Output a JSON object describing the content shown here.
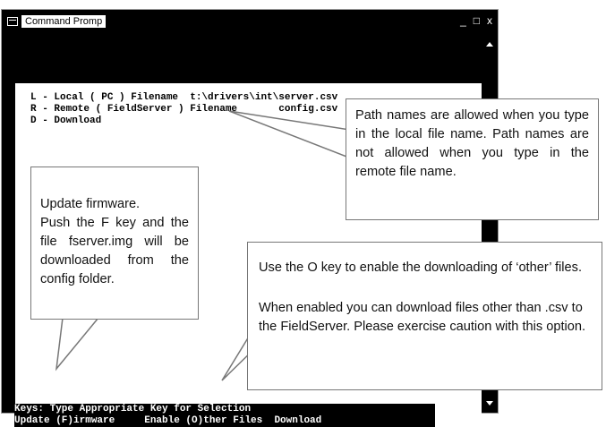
{
  "window": {
    "title": "Command Promp",
    "controls": {
      "minimize": "_",
      "maximize": "□",
      "close": "x"
    }
  },
  "console": {
    "menu_lines": [
      "L - Local ( PC ) Filename  t:\\drivers\\int\\server.csv",
      "R - Remote ( FieldServer ) Filename       config.csv",
      "D - Download"
    ],
    "keys_line": "Keys: Type Appropriate Key for Selection",
    "update_line": "Update (F)irmware     Enable (O)ther Files  Download"
  },
  "callouts": {
    "path_note": "Path names are allowed when you type in the local file name.  Path names are not allowed when you type in the remote file name.",
    "firmware_note": "Update firmware.\nPush the F key and the file fserver.img will be downloaded from the config folder.",
    "other_files_note_1": "Use the O key to enable the downloading of ‘other’ files.",
    "other_files_note_2": "When enabled you can download files other than .csv to the FieldServer. Please exercise caution with this option."
  },
  "colors": {
    "console_bg": "#000000",
    "window_bg": "#ffffff",
    "callout_border": "#777777"
  },
  "icons": {
    "window_icon": "cmd-window-icon",
    "scroll_up": "scroll-up-arrow-icon",
    "scroll_down": "scroll-down-arrow-icon"
  }
}
